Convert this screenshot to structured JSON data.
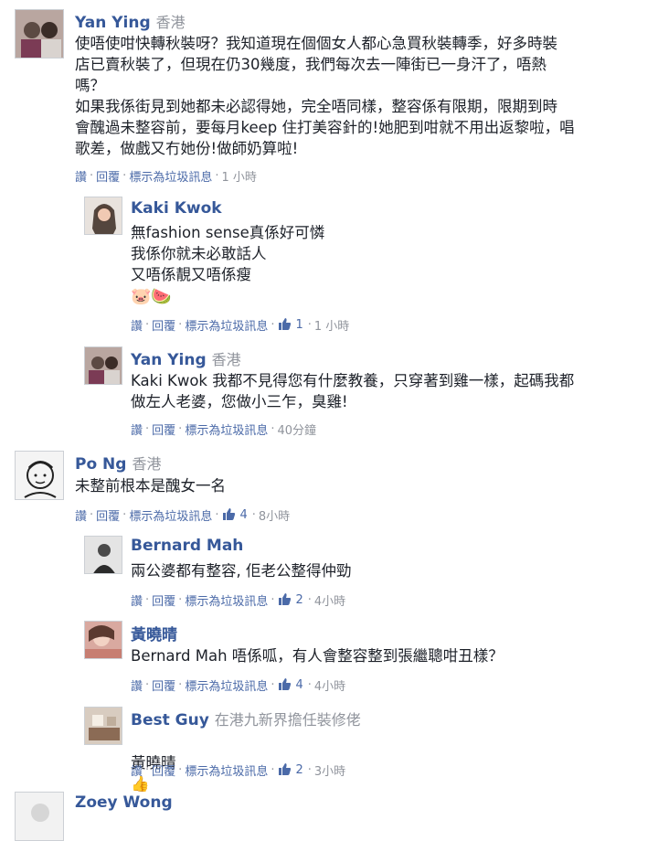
{
  "comments": [
    {
      "author": "Yan Ying",
      "location": "香港",
      "text": "使唔使咁快轉秋裝呀？我知道現在個個女人都心急買秋裝轉季，好多時裝\n店已賣秋裝了，但現在仍30幾度，我們每次去一陣街已一身汗了，唔熱\n嗎？\n如果我係街見到她都未必認得她，完全唔同樣，整容係有限期，限期到時\n會醜過未整容前，要每月keep 住打美容針的!她肥到咁就不用出返黎啦，唱\n歌差，做戲又冇她份!做師奶算啦!",
      "actions": {
        "like": "讚",
        "reply": "回覆",
        "spam": "標示為垃圾訊息",
        "time": "1 小時",
        "likes": ""
      }
    },
    {
      "author": "Kaki Kwok",
      "location": "",
      "text": "無fashion sense真係好可憐\n我係你就未必敢話人\n又唔係靚又唔係瘦",
      "emoji": "🐷🍉",
      "actions": {
        "like": "讚",
        "reply": "回覆",
        "spam": "標示為垃圾訊息",
        "time": "1 小時",
        "likes": "1"
      }
    },
    {
      "author": "Yan Ying",
      "location": "香港",
      "text": "Kaki Kwok 我都不見得您有什麼教養，只穿著到雞一樣，起碼我都\n做左人老婆，您做小三乍，臭雞!",
      "actions": {
        "like": "讚",
        "reply": "回覆",
        "spam": "標示為垃圾訊息",
        "time": "40分鐘",
        "likes": ""
      }
    },
    {
      "author": "Po Ng",
      "location": "香港",
      "text": "未整前根本是醜女一名",
      "actions": {
        "like": "讚",
        "reply": "回覆",
        "spam": "標示為垃圾訊息",
        "time": "8小時",
        "likes": "4"
      }
    },
    {
      "author": "Bernard Mah",
      "location": "",
      "text": "兩公婆都有整容, 佢老公整得仲勁",
      "actions": {
        "like": "讚",
        "reply": "回覆",
        "spam": "標示為垃圾訊息",
        "time": "4小時",
        "likes": "2"
      }
    },
    {
      "author": "黃曉晴",
      "location": "",
      "text": "Bernard Mah 唔係呱，有人會整容整到張繼聰咁丑樣？",
      "actions": {
        "like": "讚",
        "reply": "回覆",
        "spam": "標示為垃圾訊息",
        "time": "4小時",
        "likes": "4"
      }
    },
    {
      "author": "Best Guy",
      "location": "在港九新界擔任裝修佬",
      "text": "黃曉晴",
      "emoji": "👍",
      "actions": {
        "like": "讚",
        "reply": "回覆",
        "spam": "標示為垃圾訊息",
        "time": "3小時",
        "likes": "2"
      }
    },
    {
      "author": "Zoey Wong",
      "location": "",
      "text": "",
      "actions": {
        "like": "",
        "reply": "",
        "spam": "",
        "time": "",
        "likes": ""
      }
    }
  ],
  "colors": {
    "author": "#365899",
    "meta": "#90949c",
    "link": "#4b6aa8",
    "text": "#1d2129"
  },
  "icons": {
    "like": "thumbs-up-icon"
  }
}
